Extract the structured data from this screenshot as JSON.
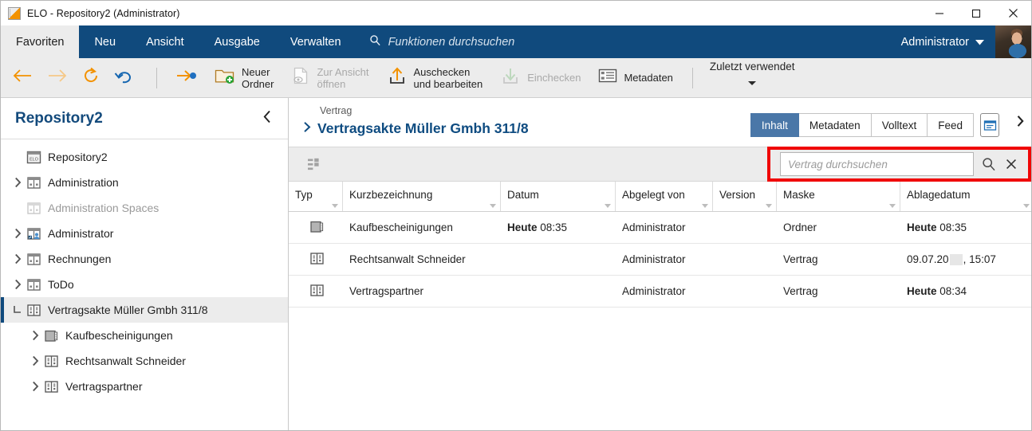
{
  "window": {
    "title": "ELO - Repository2 (Administrator)",
    "logo_icon": "elo-logo-icon",
    "minimize_label": "—",
    "maximize_label": "□",
    "close_label": "✕"
  },
  "menubar": {
    "tabs": [
      {
        "label": "Favoriten",
        "active": true
      },
      {
        "label": "Neu",
        "active": false
      },
      {
        "label": "Ansicht",
        "active": false
      },
      {
        "label": "Ausgabe",
        "active": false
      },
      {
        "label": "Verwalten",
        "active": false
      }
    ],
    "search_placeholder": "Funktionen durchsuchen",
    "search_icon": "search-icon",
    "user_name": "Administrator",
    "user_caret_icon": "chevron-down-icon",
    "avatar_icon": "user-avatar"
  },
  "toolbar": {
    "back_icon": "arrow-left-icon",
    "forward_icon": "arrow-right-icon",
    "refresh_icon": "refresh-icon",
    "undo_icon": "undo-icon",
    "goto_icon": "goto-arrow-icon",
    "items": [
      {
        "name": "neuer-ordner",
        "line1": "Neuer",
        "line2": "Ordner",
        "icon": "new-folder-icon",
        "disabled": false
      },
      {
        "name": "zur-ansicht-oeffnen",
        "line1": "Zur Ansicht",
        "line2": "öffnen",
        "icon": "document-preview-icon",
        "disabled": true
      },
      {
        "name": "auschecken-und-bearbeiten",
        "line1": "Auschecken",
        "line2": "und bearbeiten",
        "icon": "check-out-icon",
        "disabled": false
      },
      {
        "name": "einchecken",
        "line1": "Einchecken",
        "line2": "",
        "icon": "check-in-icon",
        "disabled": true
      },
      {
        "name": "metadaten",
        "line1": "Metadaten",
        "line2": "",
        "icon": "metadata-icon",
        "disabled": false
      }
    ],
    "recent_label": "Zuletzt verwendet",
    "recent_caret_icon": "caret-down-icon"
  },
  "sidebar": {
    "title": "Repository2",
    "collapse_icon": "chevron-left-icon",
    "tree": [
      {
        "label": "Repository2",
        "icon": "elo-repository-icon",
        "indent": 0,
        "twisty": "none",
        "selected": false,
        "muted": false
      },
      {
        "label": "Administration",
        "icon": "folder-cabinet-icon",
        "indent": 0,
        "twisty": "collapsed",
        "selected": false,
        "muted": false
      },
      {
        "label": "Administration Spaces",
        "icon": "folder-cabinet-dim-icon",
        "indent": 0,
        "twisty": "none",
        "selected": false,
        "muted": true
      },
      {
        "label": "Administrator",
        "icon": "folder-cabinet-user-icon",
        "indent": 0,
        "twisty": "collapsed",
        "selected": false,
        "muted": false
      },
      {
        "label": "Rechnungen",
        "icon": "folder-cabinet-icon",
        "indent": 0,
        "twisty": "collapsed",
        "selected": false,
        "muted": false
      },
      {
        "label": "ToDo",
        "icon": "folder-cabinet-icon",
        "indent": 0,
        "twisty": "collapsed",
        "selected": false,
        "muted": false
      },
      {
        "label": "Vertragsakte Müller Gmbh 311/8",
        "icon": "binder-icon",
        "indent": 0,
        "twisty": "expanded",
        "selected": true,
        "muted": false
      },
      {
        "label": "Kaufbescheinigungen",
        "icon": "document-folder-icon",
        "indent": 1,
        "twisty": "collapsed",
        "selected": false,
        "muted": false
      },
      {
        "label": "Rechtsanwalt Schneider",
        "icon": "binder-icon",
        "indent": 1,
        "twisty": "collapsed",
        "selected": false,
        "muted": false
      },
      {
        "label": "Vertragspartner",
        "icon": "binder-icon",
        "indent": 1,
        "twisty": "collapsed",
        "selected": false,
        "muted": false
      }
    ]
  },
  "main": {
    "breadcrumb_parent": "Vertrag",
    "breadcrumb_expand_icon": "chevron-right-icon",
    "title": "Vertragsakte Müller Gmbh 311/8",
    "view_tabs": [
      {
        "label": "Inhalt",
        "active": true
      },
      {
        "label": "Metadaten",
        "active": false
      },
      {
        "label": "Volltext",
        "active": false
      },
      {
        "label": "Feed",
        "active": false
      }
    ],
    "view_panel_icon": "preview-pane-icon",
    "view_more_icon": "chevron-right-icon",
    "grid_view_icon": "list-view-icon",
    "search": {
      "placeholder": "Vertrag durchsuchen",
      "value": "",
      "search_icon": "magnifier-icon",
      "close_icon": "close-icon",
      "highlight_color": "#f00606"
    },
    "table": {
      "columns": [
        {
          "key": "typ",
          "label": "Typ"
        },
        {
          "key": "kurz",
          "label": "Kurzbezeichnung"
        },
        {
          "key": "datum",
          "label": "Datum"
        },
        {
          "key": "abg",
          "label": "Abgelegt von"
        },
        {
          "key": "ver",
          "label": "Version"
        },
        {
          "key": "maske",
          "label": "Maske"
        },
        {
          "key": "abl",
          "label": "Ablagedatum"
        }
      ],
      "rows": [
        {
          "icon": "document-folder-icon",
          "kurz": "Kaufbescheinigungen",
          "datum_bold": "Heute",
          "datum_rest": "08:35",
          "abg": "Administrator",
          "ver": "",
          "maske": "Ordner",
          "abl_bold": "Heute",
          "abl_rest": "08:35",
          "abl_redacted": false
        },
        {
          "icon": "binder-icon",
          "kurz": "Rechtsanwalt Schneider",
          "datum_bold": "",
          "datum_rest": "",
          "abg": "Administrator",
          "ver": "",
          "maske": "Vertrag",
          "abl_bold": "",
          "abl_rest": "09.07.20",
          "abl_tail": ", 15:07",
          "abl_redacted": true
        },
        {
          "icon": "binder-icon",
          "kurz": "Vertragspartner",
          "datum_bold": "",
          "datum_rest": "",
          "abg": "Administrator",
          "ver": "",
          "maske": "Vertrag",
          "abl_bold": "Heute",
          "abl_rest": "08:34",
          "abl_redacted": false
        }
      ]
    }
  },
  "colors": {
    "brand_blue": "#104a7d",
    "accent_orange": "#f39200",
    "tab_active_blue": "#4a77a8",
    "highlight_red": "#f00606",
    "chrome_grey": "#ececec"
  }
}
